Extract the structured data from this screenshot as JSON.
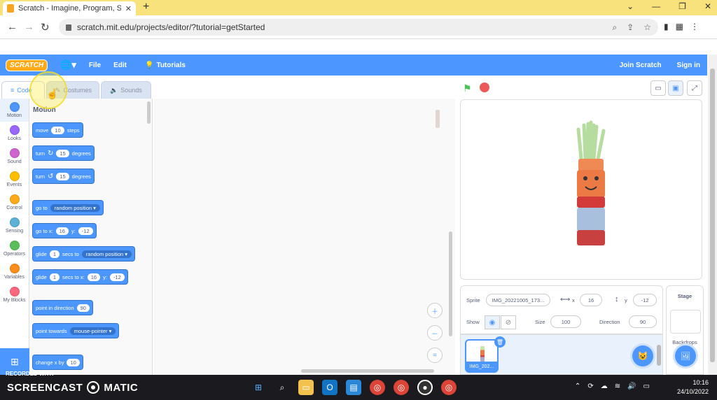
{
  "browser": {
    "tab_title": "Scratch - Imagine, Program, Sha",
    "url": "scratch.mit.edu/projects/editor/?tutorial=getStarted"
  },
  "menubar": {
    "logo": "SCRATCH",
    "file": "File",
    "edit": "Edit",
    "tutorials": "Tutorials",
    "join": "Join Scratch",
    "signin": "Sign in"
  },
  "tabs": {
    "code": "Code",
    "costumes": "Costumes",
    "sounds": "Sounds"
  },
  "categories": [
    {
      "label": "Motion",
      "color": "#4c97ff"
    },
    {
      "label": "Looks",
      "color": "#9966ff"
    },
    {
      "label": "Sound",
      "color": "#cf63cf"
    },
    {
      "label": "Events",
      "color": "#ffbf00"
    },
    {
      "label": "Control",
      "color": "#ffab19"
    },
    {
      "label": "Sensing",
      "color": "#5cb1d6"
    },
    {
      "label": "Operators",
      "color": "#59c059"
    },
    {
      "label": "Variables",
      "color": "#ff8c1a"
    },
    {
      "label": "My Blocks",
      "color": "#ff6680"
    }
  ],
  "palette": {
    "title": "Motion",
    "move": {
      "a": "move",
      "v": "10",
      "b": "steps"
    },
    "turn_right": {
      "a": "turn",
      "v": "15",
      "b": "degrees"
    },
    "turn_left": {
      "a": "turn",
      "v": "15",
      "b": "degrees"
    },
    "goto": {
      "a": "go to",
      "v": "random position"
    },
    "gotoxy": {
      "a": "go to x:",
      "x": "16",
      "b": "y:",
      "y": "-12"
    },
    "glide_to": {
      "a": "glide",
      "v": "1",
      "b": "secs to",
      "t": "random position"
    },
    "glide_xy": {
      "a": "glide",
      "v": "1",
      "b": "secs to x:",
      "x": "16",
      "c": "y:",
      "y": "-12"
    },
    "point_dir": {
      "a": "point in direction",
      "v": "90"
    },
    "point_towards": {
      "a": "point towards",
      "v": "mouse-pointer"
    },
    "change_x": {
      "a": "change x by",
      "v": "10"
    }
  },
  "sprite_info": {
    "sprite_label": "Sprite",
    "sprite_name": "IMG_20221005_173...",
    "x_label": "x",
    "x": "16",
    "y_label": "y",
    "y": "-12",
    "show_label": "Show",
    "size_label": "Size",
    "size": "100",
    "direction_label": "Direction",
    "direction": "90"
  },
  "sprite_list": {
    "thumb_name": "IMG_202..."
  },
  "stage_panel": {
    "title": "Stage",
    "backdrops_label": "Backdrops"
  },
  "taskbar": {
    "rec_small": "RECORDED WITH",
    "rec_brand_1": "SCREENCAST",
    "rec_brand_2": "MATIC",
    "time": "10:16",
    "date": "24/10/2022"
  }
}
